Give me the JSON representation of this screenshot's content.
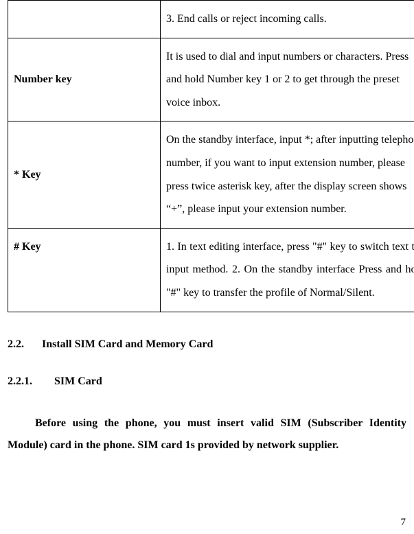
{
  "table": {
    "rows": [
      {
        "label": "",
        "desc": "3. End calls or reject incoming calls."
      },
      {
        "label": "Number key",
        "desc": "It is used to dial and input numbers or characters.   Press and hold Number key 1 or 2 to get through the preset voice inbox."
      },
      {
        "label": "* Key",
        "desc": "On the standby interface, input *; after inputting telephone number, if you want to input extension number, please press twice asterisk key, after the display screen shows “+”, please input your extension number."
      },
      {
        "label": "# Key",
        "desc": "1. In text editing interface, press \"#\" key to switch text the input method.\n2. On the standby interface Press and hold \"#\" key to transfer the profile of Normal/Silent."
      }
    ]
  },
  "section": {
    "num": "2.2.",
    "title": "Install SIM Card and Memory Card"
  },
  "subsection": {
    "num": "2.2.1.",
    "title": "SIM Card"
  },
  "paragraph": "Before using the phone, you must insert valid SIM (Subscriber Identity Module) card in the phone. SIM card 1s provided by network supplier.",
  "page_number": "7"
}
